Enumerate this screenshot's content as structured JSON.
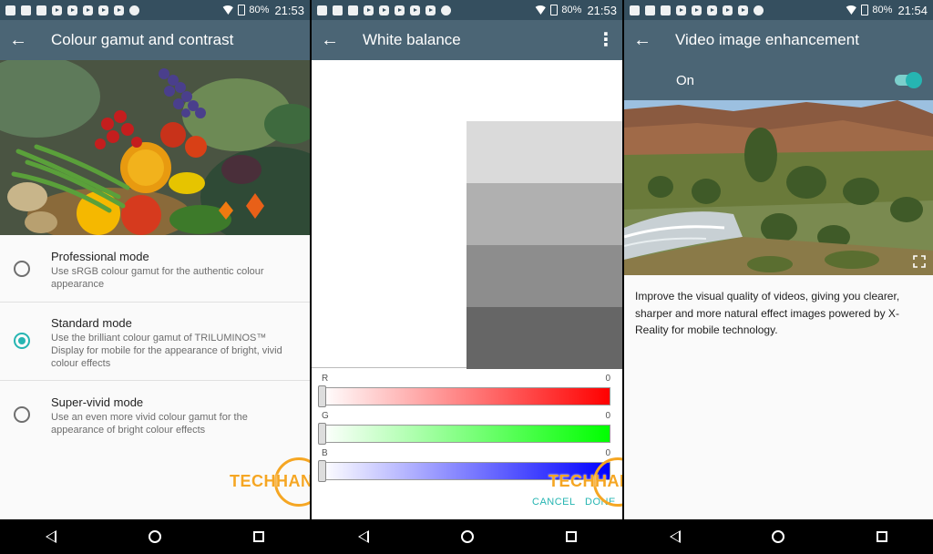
{
  "panels": [
    {
      "status": {
        "battery": "80%",
        "time": "21:53"
      },
      "title": "Colour gamut and contrast",
      "modes": [
        {
          "title": "Professional mode",
          "desc": "Use sRGB colour gamut for the authentic colour appearance",
          "selected": false
        },
        {
          "title": "Standard mode",
          "desc": "Use the brilliant colour gamut of TRILUMINOS™ Display for mobile for the appearance of bright, vivid colour effects",
          "selected": true
        },
        {
          "title": "Super-vivid mode",
          "desc": "Use an even more vivid colour gamut for the appearance of bright colour effects",
          "selected": false
        }
      ]
    },
    {
      "status": {
        "battery": "80%",
        "time": "21:53"
      },
      "title": "White balance",
      "sliders": [
        {
          "label": "R",
          "value": "0",
          "color": "#ff0000"
        },
        {
          "label": "G",
          "value": "0",
          "color": "#00ff00"
        },
        {
          "label": "B",
          "value": "0",
          "color": "#0000ff"
        }
      ],
      "cancel": "CANCEL",
      "done": "DONE"
    },
    {
      "status": {
        "battery": "80%",
        "time": "21:54"
      },
      "title": "Video image enhancement",
      "toggle_label": "On",
      "toggle_on": true,
      "description": "Improve the visual quality of videos, giving you clearer, sharper and more natural effect images powered by X-Reality for mobile technology."
    }
  ],
  "watermark": {
    "part1": "TECH",
    "part2": "HANGOUT"
  },
  "colors": {
    "accent": "#26b5b2",
    "appbar": "#4b6575",
    "statusbar": "#354f5f",
    "watermark": "#f5a623"
  }
}
